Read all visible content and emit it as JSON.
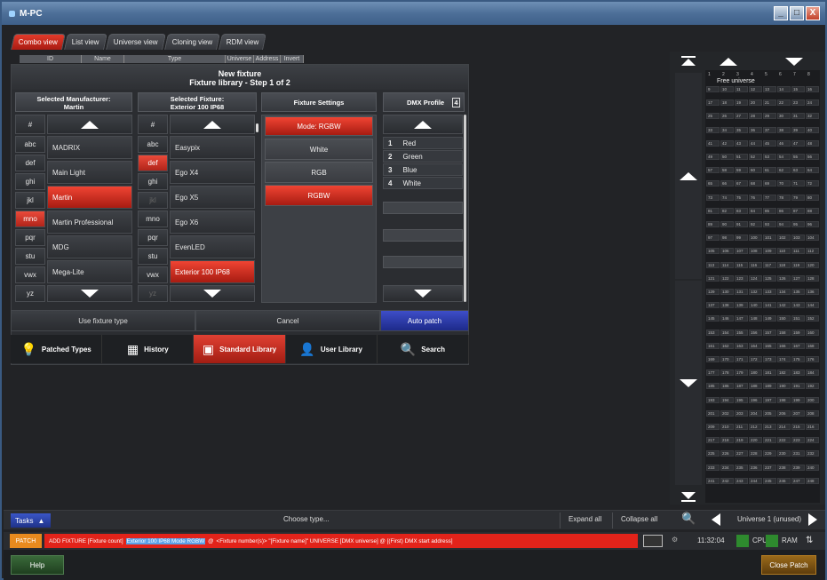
{
  "app": {
    "title": "M-PC"
  },
  "window_buttons": {
    "minimize": "_",
    "maximize": "□",
    "close": "X"
  },
  "tabs": [
    {
      "label": "Combo view",
      "active": true
    },
    {
      "label": "List view",
      "active": false
    },
    {
      "label": "Universe view",
      "active": false
    },
    {
      "label": "Cloning view",
      "active": false
    },
    {
      "label": "RDM view",
      "active": false
    }
  ],
  "list_headers": [
    "ID",
    "Name",
    "Type",
    "Universe",
    "Address",
    "Invert"
  ],
  "dialog": {
    "title": "New fixture",
    "subtitle": "Fixture library - Step 1 of 2",
    "col_manufacturer": {
      "title": "Selected Manufacturer:",
      "value": "Martin"
    },
    "col_fixture": {
      "title": "Selected Fixture:",
      "value": "Exterior 100 IP68"
    },
    "col_settings": {
      "title": "Fixture Settings"
    },
    "col_dmx": {
      "title": "DMX Profile",
      "count": "4"
    },
    "manufacturer_letters": [
      "#",
      "abc",
      "def",
      "ghi",
      "jkl",
      "mno",
      "pqr",
      "stu",
      "vwx",
      "yz"
    ],
    "manufacturer_letter_selected": "mno",
    "manufacturers": [
      "MADRIX",
      "Main Light",
      "Martin",
      "Martin Professional",
      "MDG",
      "Mega-Lite"
    ],
    "manufacturer_selected": "Martin",
    "fixture_letters": [
      "#",
      "abc",
      "def",
      "ghi",
      "jkl",
      "mno",
      "pqr",
      "stu",
      "vwx",
      "yz"
    ],
    "fixture_letter_selected": "def",
    "fixtures": [
      "Easypix",
      "Ego X4",
      "Ego X5",
      "Ego X6",
      "EvenLED",
      "Exterior 100 IP68"
    ],
    "fixture_selected": "Exterior 100 IP68",
    "settings": [
      "Mode: RGBW",
      "White",
      "RGB",
      "RGBW"
    ],
    "dmx_channels": [
      {
        "num": "1",
        "name": "Red"
      },
      {
        "num": "2",
        "name": "Green"
      },
      {
        "num": "3",
        "name": "Blue"
      },
      {
        "num": "4",
        "name": "White"
      }
    ],
    "actions": {
      "use_type": "Use fixture type",
      "cancel": "Cancel",
      "auto_patch": "Auto patch"
    },
    "library_tabs": [
      {
        "label": "Patched Types",
        "icon": "bulb-icon",
        "glyph": "💡",
        "selected": false
      },
      {
        "label": "History",
        "icon": "history-icon",
        "glyph": "▦",
        "selected": false
      },
      {
        "label": "Standard Library",
        "icon": "library-icon",
        "glyph": "▣",
        "selected": true
      },
      {
        "label": "User Library",
        "icon": "user-icon",
        "glyph": "👤",
        "selected": false
      },
      {
        "label": "Search",
        "icon": "search-icon",
        "glyph": "🔍",
        "selected": false
      }
    ]
  },
  "universe_grid": {
    "title": "Free universe",
    "column_labels": [
      "1",
      "2",
      "3",
      "4",
      "5",
      "6",
      "7",
      "8"
    ]
  },
  "bottom": {
    "tasks": "Tasks",
    "choose_type": "Choose type...",
    "expand_all": "Expand all",
    "collapse_all": "Collapse all",
    "universe_label": "Universe 1 (unused)"
  },
  "command": {
    "mode": "PATCH",
    "prefix": "ADD FIXTURE [Fixture count]",
    "fixture": "Exterior 100 IP68 Mode RGBW",
    "middle": "@",
    "suffix": "<Fixture number(s)> \"[Fixture name]\" UNIVERSE [DMX universe] @ [(First) DMX start address]"
  },
  "footer": {
    "help": "Help",
    "time": "11:32:04",
    "cpu": "CPU",
    "ram": "RAM",
    "close_patch": "Close Patch"
  },
  "colors": {
    "accent_red": "#e2231a",
    "accent_blue": "#2f44b8",
    "patch_orange": "#e88a1e"
  }
}
